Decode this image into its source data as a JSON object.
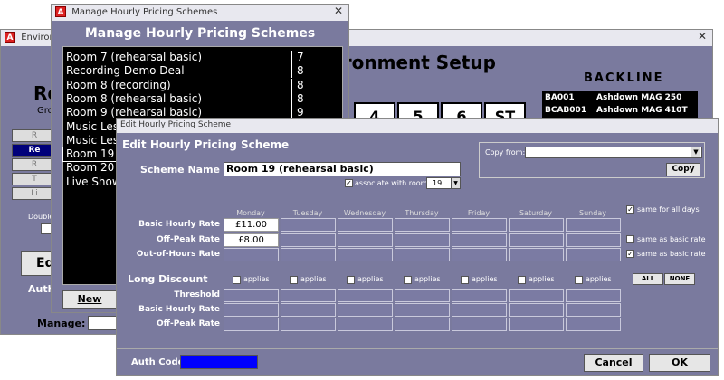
{
  "env_window": {
    "title": "Environment Setup",
    "header": "Environment Setup",
    "room_heading": "Room",
    "room_sub": "Gro",
    "side_buttons": [
      "R",
      "Re",
      "R",
      "T",
      "Li"
    ],
    "double_label": "Double",
    "edit_button": "Edi",
    "auth_label": "Auth",
    "manage_label": "Manage:",
    "tabs": [
      "4",
      "5",
      "6",
      "ST"
    ],
    "backline": {
      "title": "BACKLINE",
      "rows": [
        {
          "code": "BA001",
          "name": "Ashdown MAG 250"
        },
        {
          "code": "BCAB001",
          "name": "Ashdown MAG 410T"
        }
      ]
    }
  },
  "manage_window": {
    "title": "Manage Hourly Pricing Schemes",
    "header": "Manage Hourly Pricing Schemes",
    "rows": [
      {
        "name": "Room 7 (rehearsal basic)",
        "room": "7"
      },
      {
        "name": "Recording Demo Deal",
        "room": "8"
      },
      {
        "name": "Room 8 (recording)",
        "room": "8"
      },
      {
        "name": "Room 8 (rehearsal basic)",
        "room": "8"
      },
      {
        "name": "Room 9 (rehearsal basic)",
        "room": "9"
      },
      {
        "name": "Music Les",
        "room": ""
      },
      {
        "name": "Music Les",
        "room": ""
      },
      {
        "name": "Room 19 (",
        "room": ""
      },
      {
        "name": "Room 20 (",
        "room": ""
      },
      {
        "name": "Live Show",
        "room": ""
      }
    ],
    "selected_index": 7,
    "new_button": "New"
  },
  "edit_window": {
    "title": "Edit Hourly Pricing Scheme",
    "header": "Edit Hourly Pricing Scheme",
    "copy_from_label": "Copy from:",
    "copy_from_value": "",
    "copy_button": "Copy",
    "scheme_name_label": "Scheme Name",
    "scheme_name_value": "Room 19 (rehearsal basic)",
    "associate_label": "associate with room:",
    "associate_checked": true,
    "room_value": "19",
    "days": [
      "Monday",
      "Tuesday",
      "Wednesday",
      "Thursday",
      "Friday",
      "Saturday",
      "Sunday"
    ],
    "rate_rows": [
      {
        "label": "Basic Hourly Rate",
        "values": [
          "£11.00",
          "",
          "",
          "",
          "",
          "",
          ""
        ]
      },
      {
        "label": "Off-Peak Rate",
        "values": [
          "£8.00",
          "",
          "",
          "",
          "",
          "",
          ""
        ]
      },
      {
        "label": "Out-of-Hours Rate",
        "values": [
          "",
          "",
          "",
          "",
          "",
          "",
          ""
        ]
      }
    ],
    "side_options": [
      {
        "label": "same for all days",
        "checked": true
      },
      {
        "label": "same as basic rate",
        "checked": false
      },
      {
        "label": "same as basic rate",
        "checked": true
      }
    ],
    "long_discount_label": "Long Discount",
    "applies_label": "applies",
    "all_button": "ALL",
    "none_button": "NONE",
    "discount_rows": [
      "Threshold",
      "Basic Hourly Rate",
      "Off-Peak Rate"
    ],
    "auth_code_label": "Auth Code",
    "cancel_button": "Cancel",
    "ok_button": "OK",
    "colors": {
      "window_bg": "#7a7a9e",
      "auth_field": "#0000ff",
      "list_bg": "#000000"
    }
  }
}
